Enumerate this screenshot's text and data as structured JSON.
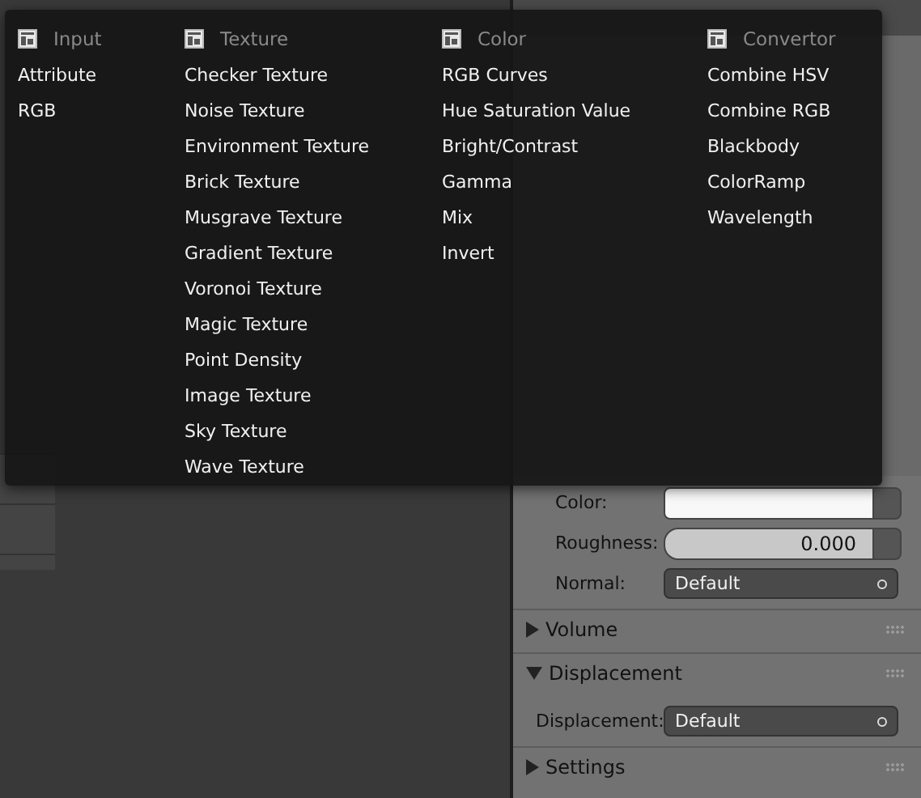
{
  "add_menu": {
    "columns": [
      {
        "header": "Input",
        "items": [
          "Attribute",
          "RGB"
        ]
      },
      {
        "header": "Texture",
        "items": [
          "Checker Texture",
          "Noise Texture",
          "Environment Texture",
          "Brick Texture",
          "Musgrave Texture",
          "Gradient Texture",
          "Voronoi Texture",
          "Magic Texture",
          "Point Density",
          "Image Texture",
          "Sky Texture",
          "Wave Texture"
        ]
      },
      {
        "header": "Color",
        "items": [
          "RGB Curves",
          "Hue Saturation Value",
          "Bright/Contrast",
          "Gamma",
          "Mix",
          "Invert"
        ]
      },
      {
        "header": "Convertor",
        "items": [
          "Combine HSV",
          "Combine RGB",
          "Blackbody",
          "ColorRamp",
          "Wavelength"
        ]
      }
    ]
  },
  "properties": {
    "rows": [
      {
        "kind": "color",
        "label": "Color:"
      },
      {
        "kind": "slider",
        "label": "Roughness:",
        "value": "0.000",
        "level": 0
      },
      {
        "kind": "dropdown",
        "label": "Normal:",
        "value": "Default"
      },
      {
        "kind": "section",
        "title": "Volume",
        "expanded": false
      },
      {
        "kind": "section",
        "title": "Displacement",
        "expanded": true
      },
      {
        "kind": "dropdown",
        "label": "Displacement:",
        "value": "Default"
      },
      {
        "kind": "section",
        "title": "Settings",
        "expanded": false
      }
    ]
  }
}
